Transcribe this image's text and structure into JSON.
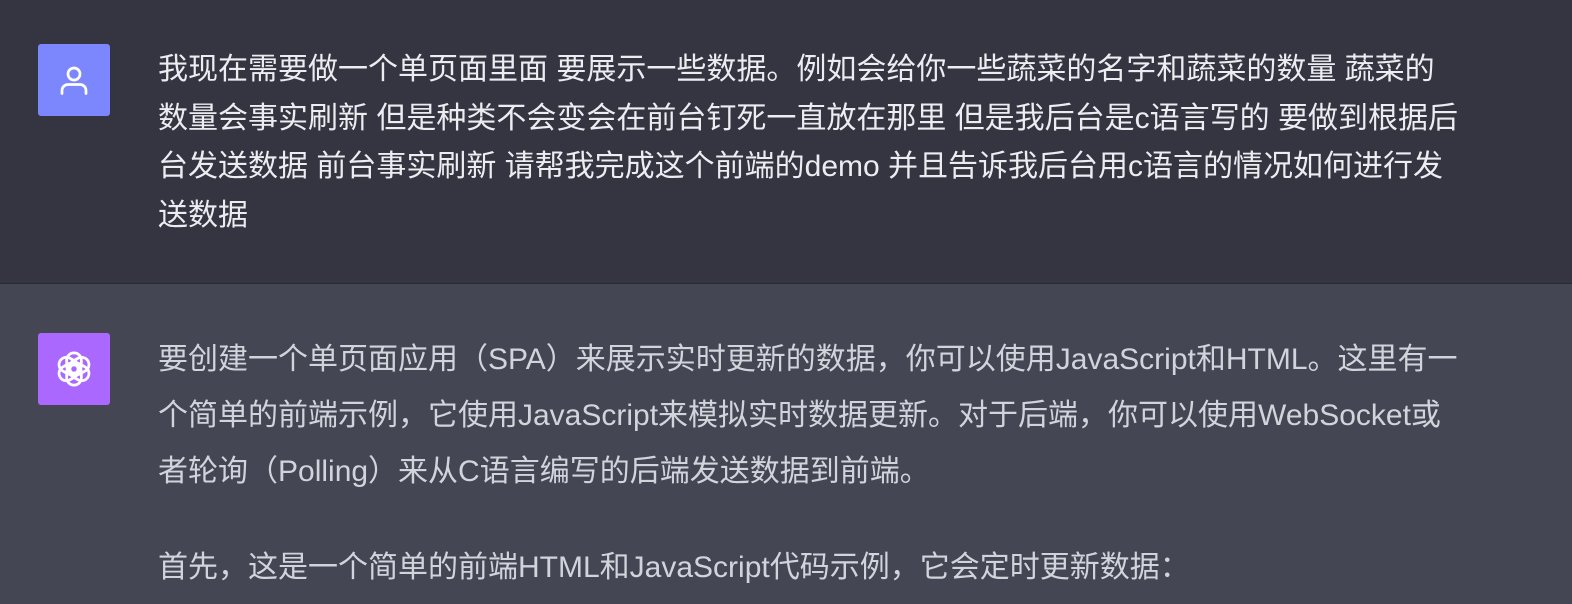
{
  "colors": {
    "user_background": "#343541",
    "assistant_background": "#444654",
    "user_avatar": "#7d87fd",
    "assistant_avatar": "#ab68ff",
    "text": "#ececf1",
    "assistant_text": "#d1d5db"
  },
  "messages": [
    {
      "role": "user",
      "avatar_icon": "user-icon",
      "text": "我现在需要做一个单页面里面 要展示一些数据。例如会给你一些蔬菜的名字和蔬菜的数量  蔬菜的数量会事实刷新 但是种类不会变会在前台钉死一直放在那里 但是我后台是c语言写的  要做到根据后台发送数据 前台事实刷新 请帮我完成这个前端的demo 并且告诉我后台用c语言的情况如何进行发送数据"
    },
    {
      "role": "assistant",
      "avatar_icon": "openai-logo-icon",
      "paragraphs": [
        "要创建一个单页面应用（SPA）来展示实时更新的数据，你可以使用JavaScript和HTML。这里有一个简单的前端示例，它使用JavaScript来模拟实时数据更新。对于后端，你可以使用WebSocket或者轮询（Polling）来从C语言编写的后端发送数据到前端。",
        "首先，这是一个简单的前端HTML和JavaScript代码示例，它会定时更新数据："
      ]
    }
  ]
}
